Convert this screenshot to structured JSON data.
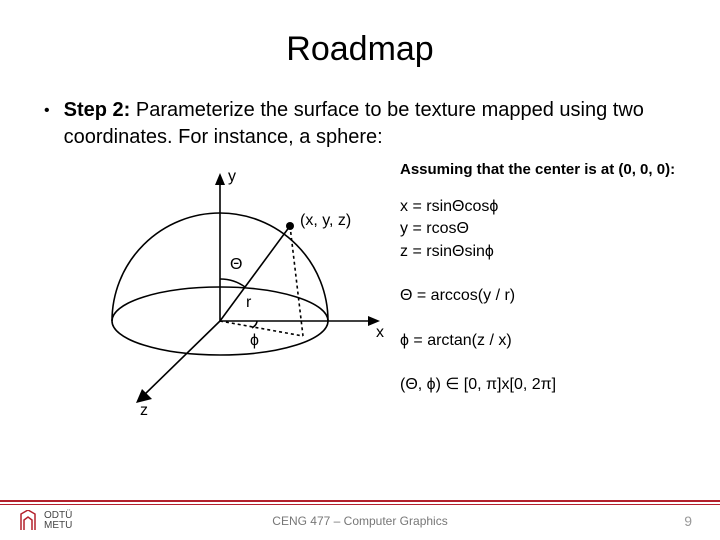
{
  "title": "Roadmap",
  "bullet": {
    "step_label": "Step 2:",
    "rest": " Parameterize the surface to be texture mapped using two coordinates. For instance, a sphere:"
  },
  "diagram": {
    "axis_x": "x",
    "axis_y": "y",
    "axis_z": "z",
    "radius_label": "r",
    "theta_label": "Θ",
    "phi_label": "ϕ",
    "point_label": "(x, y, z)"
  },
  "equations": {
    "assume": "Assuming that the center is at (0, 0, 0):",
    "x": "x = rsinΘcosϕ",
    "y": "y = rcosΘ",
    "z": "z = rsinΘsinϕ",
    "theta": "Θ = arccos(y / r)",
    "phi": "ϕ = arctan(z / x)",
    "domain": "(Θ, ϕ) ∈  [0, π]x[0, 2π]"
  },
  "footer": {
    "logo_top": "ODTÜ",
    "logo_bottom": "METU",
    "center": "CENG 477 – Computer Graphics",
    "page": "9"
  }
}
